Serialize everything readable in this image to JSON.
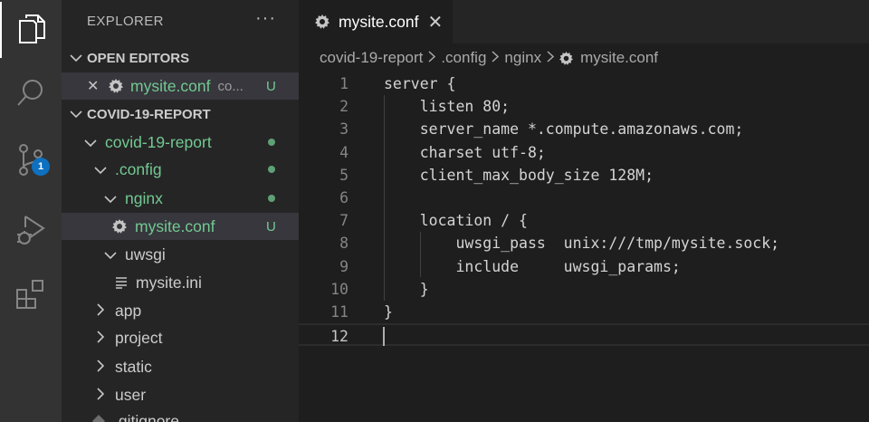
{
  "sidebar": {
    "title": "EXPLORER",
    "more": "···",
    "open_editors": {
      "label": "OPEN EDITORS",
      "items": [
        {
          "close": "✕",
          "name": "mysite.conf",
          "desc": "co...",
          "status": "U"
        }
      ]
    },
    "project": {
      "label": "COVID-19-REPORT",
      "tree": [
        {
          "name": "covid-19-report"
        },
        {
          "name": ".config"
        },
        {
          "name": "nginx"
        },
        {
          "name": "mysite.conf",
          "status": "U"
        },
        {
          "name": "uwsgi"
        },
        {
          "name": "mysite.ini"
        },
        {
          "name": "app"
        },
        {
          "name": "project"
        },
        {
          "name": "static"
        },
        {
          "name": "user"
        },
        {
          "name": ".gitignore"
        }
      ]
    }
  },
  "activity": {
    "scm_badge": "1"
  },
  "editor": {
    "tab": {
      "label": "mysite.conf",
      "close": "✕"
    },
    "breadcrumb": [
      "covid-19-report",
      ".config",
      "nginx",
      "mysite.conf"
    ],
    "lines": [
      {
        "n": "1",
        "text": "server {"
      },
      {
        "n": "2",
        "text": "    listen 80;"
      },
      {
        "n": "3",
        "text": "    server_name *.compute.amazonaws.com;"
      },
      {
        "n": "4",
        "text": "    charset utf-8;"
      },
      {
        "n": "5",
        "text": "    client_max_body_size 128M;"
      },
      {
        "n": "6",
        "text": ""
      },
      {
        "n": "7",
        "text": "    location / {"
      },
      {
        "n": "8",
        "text": "        uwsgi_pass  unix:///tmp/mysite.sock;"
      },
      {
        "n": "9",
        "text": "        include     uwsgi_params;"
      },
      {
        "n": "10",
        "text": "    }"
      },
      {
        "n": "11",
        "text": "}"
      },
      {
        "n": "12",
        "text": ""
      }
    ]
  }
}
